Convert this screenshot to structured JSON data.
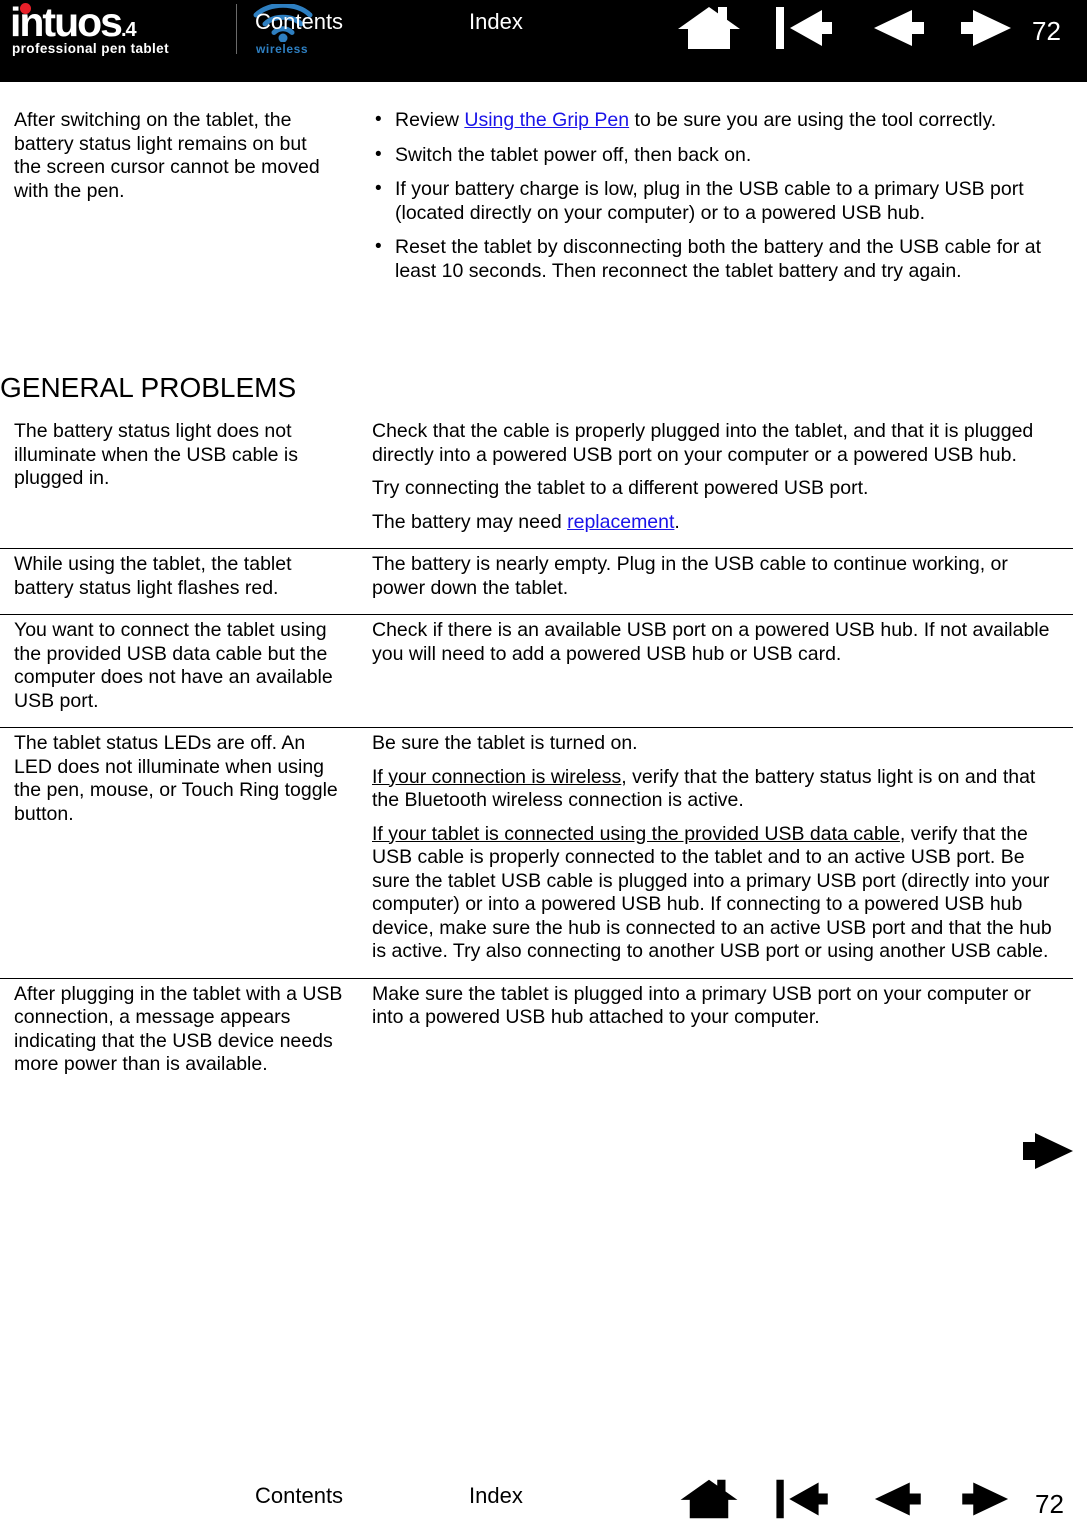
{
  "header": {
    "logo": {
      "wordmark": "intuos",
      "model": ".4",
      "tagline": "professional pen tablet",
      "wireless_label": "wireless",
      "dot_color": "#e8202a",
      "wireless_color": "#2e7fc1"
    },
    "contents_label": "Contents",
    "index_label": "Index",
    "page_number": "72",
    "nav_icons": [
      "home-icon",
      "first-page-icon",
      "previous-page-icon",
      "next-page-icon"
    ],
    "background_color": "#000000",
    "text_color": "#ffffff"
  },
  "intro": {
    "symptom": "After switching on the tablet, the battery status light remains on but the screen cursor cannot be moved with the pen.",
    "solutions": [
      {
        "pre": "Review ",
        "link": "Using the Grip Pen",
        "post": " to be sure you are using the tool correctly."
      },
      {
        "pre": "Switch the tablet power off, then back on.",
        "link": "",
        "post": ""
      },
      {
        "pre": "If your battery charge is low, plug in the USB cable to a primary USB port (located directly on your computer) or to a powered USB hub.",
        "link": "",
        "post": ""
      },
      {
        "pre": "Reset the tablet by disconnecting both the battery and the USB cable for at least 10 seconds.  Then reconnect the tablet battery and try again.",
        "link": "",
        "post": ""
      }
    ]
  },
  "section": {
    "heading": "GENERAL PROBLEMS"
  },
  "table": {
    "rows": [
      {
        "symptom": "The battery status light does not illuminate when the USB cable is plugged in.",
        "solution_paras": [
          {
            "text": "Check that the cable is properly plugged into the tablet, and that it is plugged directly into a powered USB port on your computer or a powered USB hub."
          },
          {
            "text": "Try connecting the tablet to a different powered USB port."
          },
          {
            "pre": "The battery may need ",
            "link": "replacement",
            "post": "."
          }
        ]
      },
      {
        "symptom": "While using the tablet, the tablet battery status light flashes red.",
        "solution_paras": [
          {
            "text": "The battery is nearly empty.  Plug in the USB cable to continue working, or power down the tablet."
          }
        ]
      },
      {
        "symptom": "You want to connect the tablet using the provided USB data cable but the computer does not have an available USB port.",
        "solution_paras": [
          {
            "text": "Check if there is an available USB port on a powered USB hub.  If not available you will need to add a powered USB hub or USB card."
          }
        ]
      },
      {
        "symptom": "The tablet status LEDs are off. An LED does not illuminate when using the pen, mouse, or Touch Ring toggle button.",
        "solution_paras": [
          {
            "text": "Be sure the tablet is turned on."
          },
          {
            "underline": "If your connection is wireless",
            "post": ", verify that the battery status light is on and that the Bluetooth wireless connection is active."
          },
          {
            "underline": "If your tablet is connected using the provided USB data cable",
            "post": ", verify that the USB cable is properly connected to the tablet and to an active USB port.  Be sure the tablet USB cable is plugged into a primary USB port (directly into your computer) or into a powered USB hub.\nIf connecting to a powered USB hub device, make sure the hub is connected to an active USB port and that the hub is active.  Try also connecting to another USB port or using another USB cable."
          }
        ]
      },
      {
        "symptom": "After plugging in the tablet with a USB connection, a message appears indicating that the USB device needs more power than is available.",
        "solution_paras": [
          {
            "text": "Make sure the tablet is plugged into a primary USB port on your computer or into a powered USB hub attached to your computer."
          }
        ]
      }
    ]
  },
  "jump_arrow": {
    "icon": "next-page-arrow-icon"
  },
  "footer": {
    "contents_label": "Contents",
    "index_label": "Index",
    "page_number": "72",
    "nav_icons": [
      "home-icon",
      "first-page-icon",
      "previous-page-icon",
      "next-page-icon"
    ],
    "text_color": "#000000"
  },
  "link_color": "#1a13e8"
}
